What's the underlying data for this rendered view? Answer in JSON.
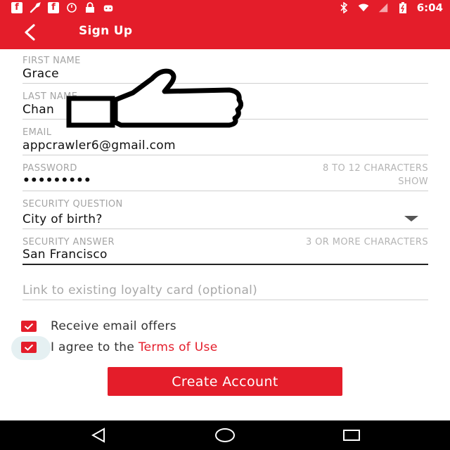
{
  "status_bar": {
    "time": "6:04",
    "left_icons": [
      "facebook-icon",
      "wrench-icon",
      "facebook-icon",
      "alarm-icon",
      "lock-icon",
      "android-icon"
    ],
    "right_icons": [
      "bluetooth-icon",
      "wifi-icon",
      "signal-icon",
      "battery-icon"
    ]
  },
  "app_bar": {
    "title": "Sign Up",
    "back_icon": "back-arrow-icon"
  },
  "form": {
    "first_name": {
      "label": "FIRST NAME",
      "value": "Grace"
    },
    "last_name": {
      "label": "LAST NAME",
      "value": "Chan"
    },
    "email": {
      "label": "EMAIL",
      "value": "appcrawler6@gmail.com"
    },
    "password": {
      "label": "PASSWORD",
      "value": "•••••••••",
      "hint": "8 TO 12 CHARACTERS",
      "toggle": "SHOW"
    },
    "security_question": {
      "label": "SECURITY QUESTION",
      "value": "City of birth?"
    },
    "security_answer": {
      "label": "SECURITY ANSWER",
      "value": "San Francisco",
      "hint": "3 OR MORE CHARACTERS"
    },
    "loyalty_card": {
      "placeholder": "Link to existing loyalty card (optional)"
    }
  },
  "checkboxes": {
    "email_offers": {
      "label": "Receive email offers",
      "checked": true
    },
    "terms": {
      "label_prefix": "I agree to the ",
      "link": "Terms of Use",
      "checked": true
    }
  },
  "create_button": {
    "label": "Create Account"
  },
  "colors": {
    "brand": "#e41d2a",
    "text": "#111111",
    "label": "#a4a4a4"
  }
}
